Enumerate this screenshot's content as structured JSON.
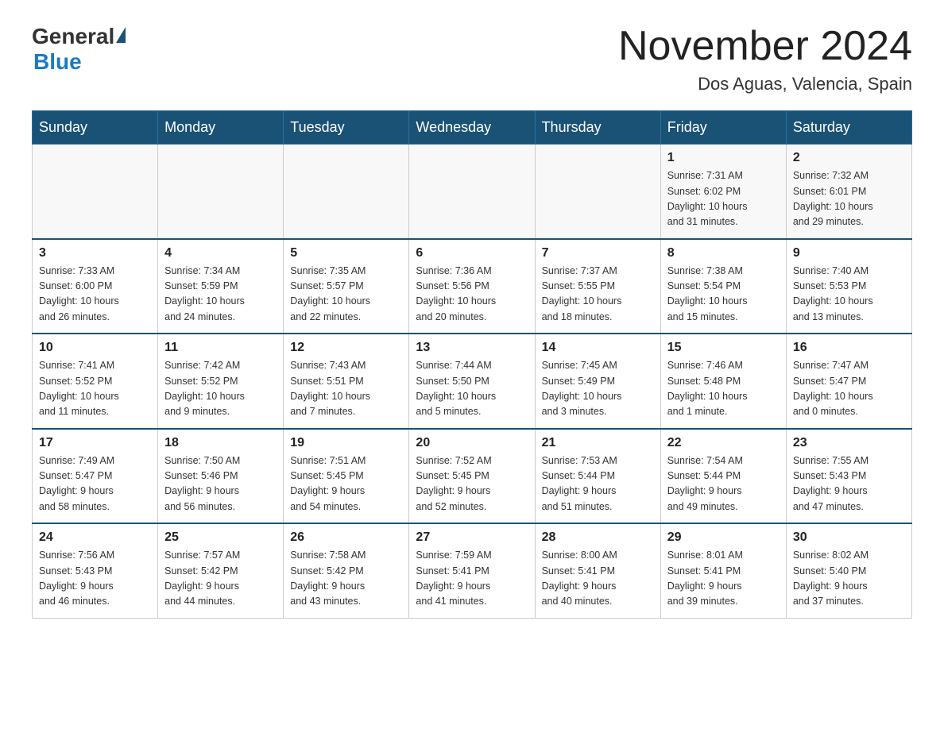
{
  "header": {
    "logo_general": "General",
    "logo_blue": "Blue",
    "month_title": "November 2024",
    "location": "Dos Aguas, Valencia, Spain"
  },
  "days_of_week": [
    "Sunday",
    "Monday",
    "Tuesday",
    "Wednesday",
    "Thursday",
    "Friday",
    "Saturday"
  ],
  "weeks": [
    [
      {
        "day": "",
        "info": ""
      },
      {
        "day": "",
        "info": ""
      },
      {
        "day": "",
        "info": ""
      },
      {
        "day": "",
        "info": ""
      },
      {
        "day": "",
        "info": ""
      },
      {
        "day": "1",
        "info": "Sunrise: 7:31 AM\nSunset: 6:02 PM\nDaylight: 10 hours\nand 31 minutes."
      },
      {
        "day": "2",
        "info": "Sunrise: 7:32 AM\nSunset: 6:01 PM\nDaylight: 10 hours\nand 29 minutes."
      }
    ],
    [
      {
        "day": "3",
        "info": "Sunrise: 7:33 AM\nSunset: 6:00 PM\nDaylight: 10 hours\nand 26 minutes."
      },
      {
        "day": "4",
        "info": "Sunrise: 7:34 AM\nSunset: 5:59 PM\nDaylight: 10 hours\nand 24 minutes."
      },
      {
        "day": "5",
        "info": "Sunrise: 7:35 AM\nSunset: 5:57 PM\nDaylight: 10 hours\nand 22 minutes."
      },
      {
        "day": "6",
        "info": "Sunrise: 7:36 AM\nSunset: 5:56 PM\nDaylight: 10 hours\nand 20 minutes."
      },
      {
        "day": "7",
        "info": "Sunrise: 7:37 AM\nSunset: 5:55 PM\nDaylight: 10 hours\nand 18 minutes."
      },
      {
        "day": "8",
        "info": "Sunrise: 7:38 AM\nSunset: 5:54 PM\nDaylight: 10 hours\nand 15 minutes."
      },
      {
        "day": "9",
        "info": "Sunrise: 7:40 AM\nSunset: 5:53 PM\nDaylight: 10 hours\nand 13 minutes."
      }
    ],
    [
      {
        "day": "10",
        "info": "Sunrise: 7:41 AM\nSunset: 5:52 PM\nDaylight: 10 hours\nand 11 minutes."
      },
      {
        "day": "11",
        "info": "Sunrise: 7:42 AM\nSunset: 5:52 PM\nDaylight: 10 hours\nand 9 minutes."
      },
      {
        "day": "12",
        "info": "Sunrise: 7:43 AM\nSunset: 5:51 PM\nDaylight: 10 hours\nand 7 minutes."
      },
      {
        "day": "13",
        "info": "Sunrise: 7:44 AM\nSunset: 5:50 PM\nDaylight: 10 hours\nand 5 minutes."
      },
      {
        "day": "14",
        "info": "Sunrise: 7:45 AM\nSunset: 5:49 PM\nDaylight: 10 hours\nand 3 minutes."
      },
      {
        "day": "15",
        "info": "Sunrise: 7:46 AM\nSunset: 5:48 PM\nDaylight: 10 hours\nand 1 minute."
      },
      {
        "day": "16",
        "info": "Sunrise: 7:47 AM\nSunset: 5:47 PM\nDaylight: 10 hours\nand 0 minutes."
      }
    ],
    [
      {
        "day": "17",
        "info": "Sunrise: 7:49 AM\nSunset: 5:47 PM\nDaylight: 9 hours\nand 58 minutes."
      },
      {
        "day": "18",
        "info": "Sunrise: 7:50 AM\nSunset: 5:46 PM\nDaylight: 9 hours\nand 56 minutes."
      },
      {
        "day": "19",
        "info": "Sunrise: 7:51 AM\nSunset: 5:45 PM\nDaylight: 9 hours\nand 54 minutes."
      },
      {
        "day": "20",
        "info": "Sunrise: 7:52 AM\nSunset: 5:45 PM\nDaylight: 9 hours\nand 52 minutes."
      },
      {
        "day": "21",
        "info": "Sunrise: 7:53 AM\nSunset: 5:44 PM\nDaylight: 9 hours\nand 51 minutes."
      },
      {
        "day": "22",
        "info": "Sunrise: 7:54 AM\nSunset: 5:44 PM\nDaylight: 9 hours\nand 49 minutes."
      },
      {
        "day": "23",
        "info": "Sunrise: 7:55 AM\nSunset: 5:43 PM\nDaylight: 9 hours\nand 47 minutes."
      }
    ],
    [
      {
        "day": "24",
        "info": "Sunrise: 7:56 AM\nSunset: 5:43 PM\nDaylight: 9 hours\nand 46 minutes."
      },
      {
        "day": "25",
        "info": "Sunrise: 7:57 AM\nSunset: 5:42 PM\nDaylight: 9 hours\nand 44 minutes."
      },
      {
        "day": "26",
        "info": "Sunrise: 7:58 AM\nSunset: 5:42 PM\nDaylight: 9 hours\nand 43 minutes."
      },
      {
        "day": "27",
        "info": "Sunrise: 7:59 AM\nSunset: 5:41 PM\nDaylight: 9 hours\nand 41 minutes."
      },
      {
        "day": "28",
        "info": "Sunrise: 8:00 AM\nSunset: 5:41 PM\nDaylight: 9 hours\nand 40 minutes."
      },
      {
        "day": "29",
        "info": "Sunrise: 8:01 AM\nSunset: 5:41 PM\nDaylight: 9 hours\nand 39 minutes."
      },
      {
        "day": "30",
        "info": "Sunrise: 8:02 AM\nSunset: 5:40 PM\nDaylight: 9 hours\nand 37 minutes."
      }
    ]
  ]
}
